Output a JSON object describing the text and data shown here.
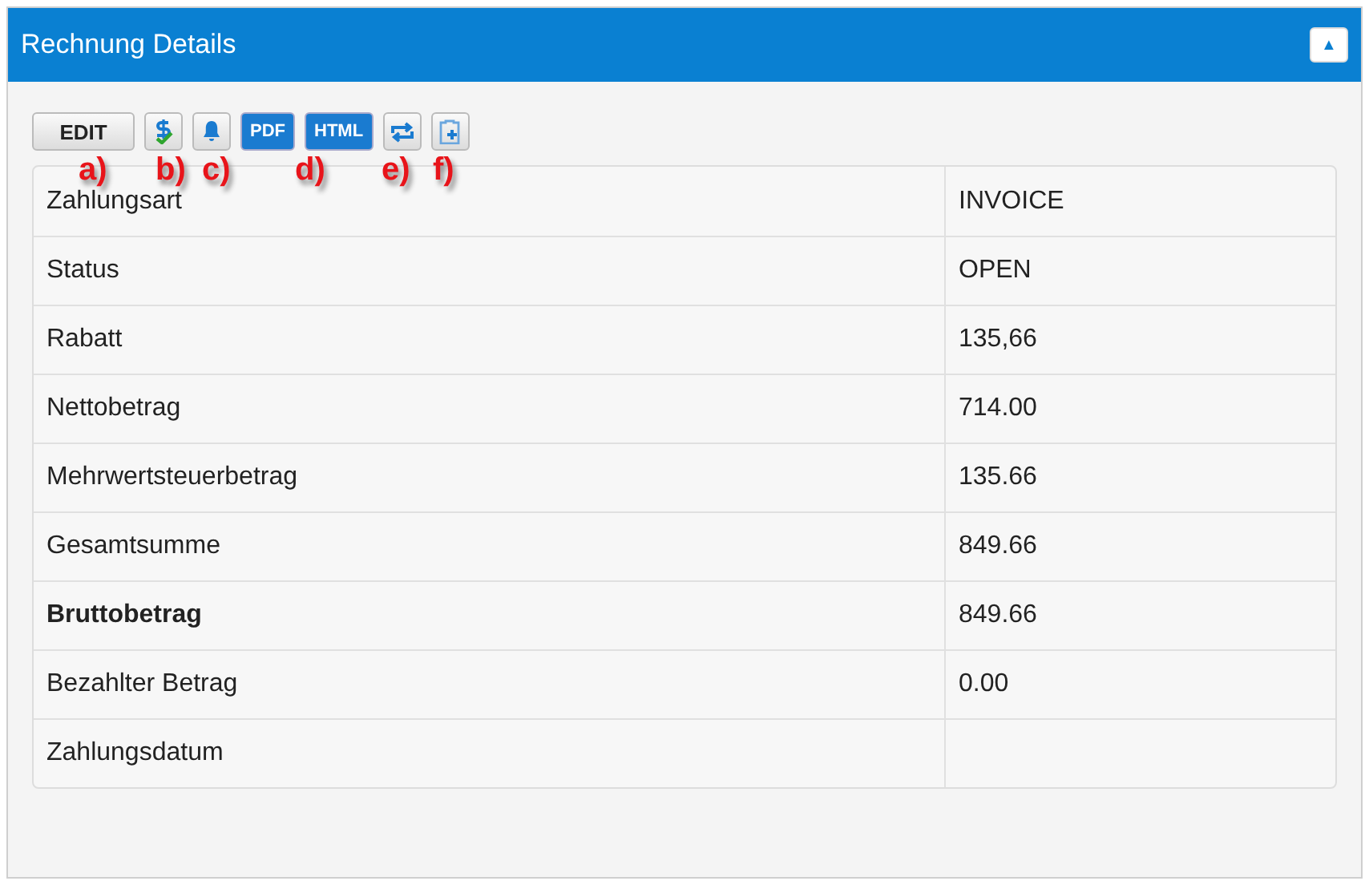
{
  "panel": {
    "title": "Rechnung Details",
    "collapse_icon": "▲"
  },
  "toolbar": [
    {
      "kind": "text",
      "label": "EDIT"
    },
    {
      "kind": "dollar-check"
    },
    {
      "kind": "bell"
    },
    {
      "kind": "badge",
      "label": "PDF"
    },
    {
      "kind": "badge",
      "label": "HTML"
    },
    {
      "kind": "repeat"
    },
    {
      "kind": "clipboard-plus"
    }
  ],
  "annotations": [
    "a)",
    "b)",
    "c)",
    "d)",
    "e)",
    "f)"
  ],
  "rows": [
    {
      "label": "Zahlungsart",
      "value": "INVOICE",
      "bold": false
    },
    {
      "label": "Status",
      "value": "OPEN",
      "bold": false
    },
    {
      "label": "Rabatt",
      "value": "135,66",
      "bold": false
    },
    {
      "label": "Nettobetrag",
      "value": "714.00",
      "bold": false
    },
    {
      "label": "Mehrwertsteuerbetrag",
      "value": "135.66",
      "bold": false
    },
    {
      "label": "Gesamtsumme",
      "value": "849.66",
      "bold": false
    },
    {
      "label": "Bruttobetrag",
      "value": "849.66",
      "bold": true
    },
    {
      "label": "Bezahlter Betrag",
      "value": "0.00",
      "bold": false
    },
    {
      "label": "Zahlungsdatum",
      "bold": false
    }
  ]
}
